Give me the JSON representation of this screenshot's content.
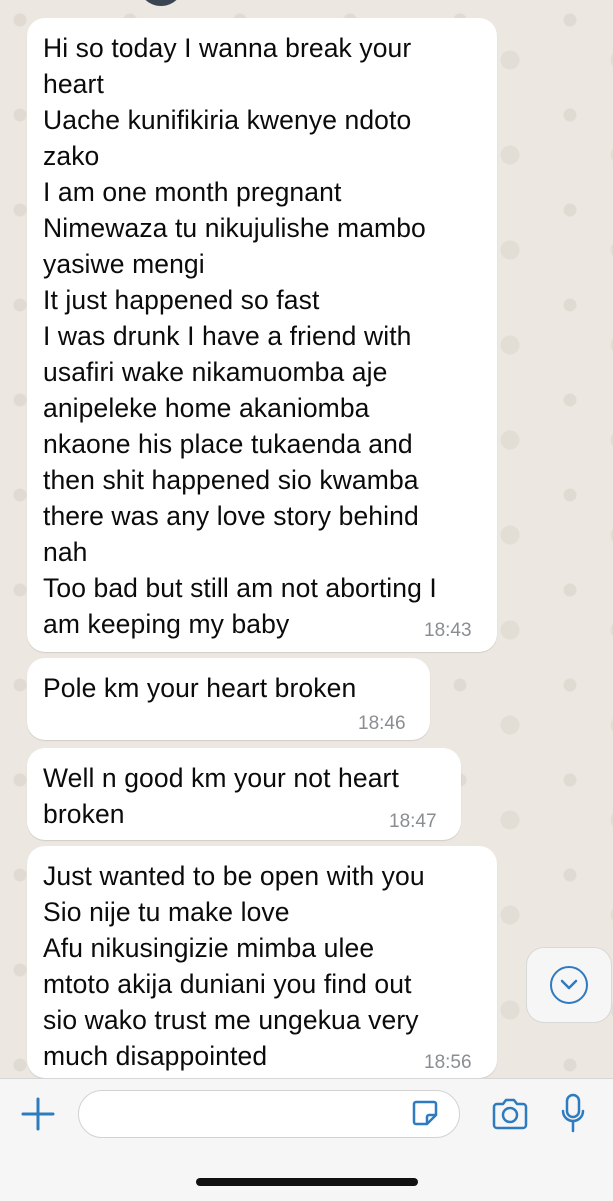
{
  "messages": [
    {
      "text": "Hi so today I wanna break your\nheart\nUache kunifikiria kwenye ndoto\nzako\nI am one month pregnant\nNimewaza tu nikujulishe mambo\nyasiwe mengi\nIt just happened so fast\nI was drunk I have a friend with\nusafiri wake nikamuomba aje\nanipeleke home akaniomba\nnkaone his place tukaenda and\nthen shit happened sio kwamba\nthere was any love story behind\nnah\nToo bad but still am not aborting I\nam keeping my baby",
      "time": "18:43"
    },
    {
      "text": "Pole km your heart broken",
      "time": "18:46"
    },
    {
      "text": "Well n good km your not heart\nbroken",
      "time": "18:47"
    },
    {
      "text": "Just wanted to be open with you\nSio nije tu make love\nAfu nikusingizie mimba ulee\nmtoto akija duniani you find out\nsio wako trust me ungekua very\nmuch disappointed",
      "time": "18:56"
    }
  ],
  "composer": {
    "plus_icon": "plus-icon",
    "sticker_icon": "sticker-icon",
    "camera_icon": "camera-icon",
    "mic_icon": "microphone-icon"
  },
  "scroll_button_icon": "chevron-down-icon",
  "colors": {
    "bubble": "#ffffff",
    "wallpaper": "#efeae2",
    "accent": "#2e7bbf",
    "timestamp": "#8a8d91"
  }
}
